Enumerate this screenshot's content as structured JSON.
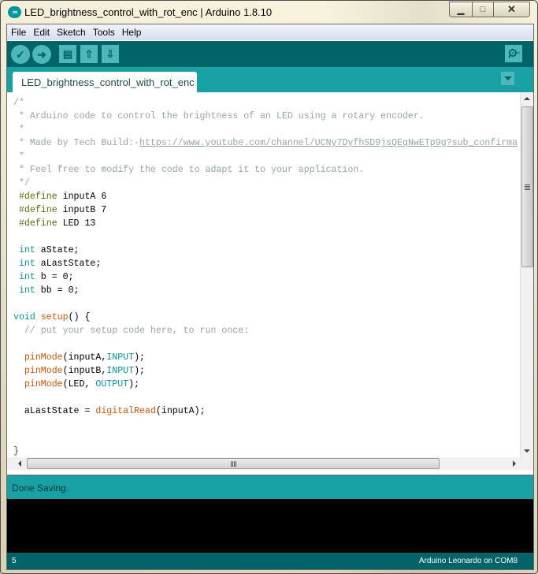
{
  "window": {
    "title": "LED_brightness_control_with_rot_enc | Arduino 1.8.10",
    "logo_glyph": "∞",
    "controls": {
      "minimize": "▁",
      "maximize": "□",
      "close": "✕"
    }
  },
  "menubar": {
    "items": [
      "File",
      "Edit",
      "Sketch",
      "Tools",
      "Help"
    ]
  },
  "toolbar": {
    "buttons": [
      {
        "name": "verify",
        "glyph": "✓"
      },
      {
        "name": "upload",
        "glyph": "➜"
      },
      {
        "name": "new",
        "glyph": "▤"
      },
      {
        "name": "open",
        "glyph": "⇧"
      },
      {
        "name": "save",
        "glyph": "⇩"
      }
    ],
    "serial_monitor": "serial-monitor"
  },
  "tabs": [
    {
      "label": "LED_brightness_control_with_rot_enc",
      "active": true
    }
  ],
  "editor": {
    "lines": [
      [
        {
          "t": "/*",
          "c": "comment"
        }
      ],
      [
        {
          "t": " * Arduino code to control the brightness of an LED using a rotary encoder.",
          "c": "comment"
        }
      ],
      [
        {
          "t": " *",
          "c": "comment"
        }
      ],
      [
        {
          "t": " * Made by Tech Build:-",
          "c": "comment"
        },
        {
          "t": "https://www.youtube.com/channel/UCNy7DyfhSD9jsQEqNwETp9g?sub_confirma",
          "c": "link"
        }
      ],
      [
        {
          "t": " *",
          "c": "comment"
        }
      ],
      [
        {
          "t": " * Feel free to modify the code to adapt it to your application.",
          "c": "comment"
        }
      ],
      [
        {
          "t": " */",
          "c": "comment"
        }
      ],
      [
        {
          "t": " #define",
          "c": "pre"
        },
        {
          "t": " inputA 6",
          "c": ""
        }
      ],
      [
        {
          "t": " #define",
          "c": "pre"
        },
        {
          "t": " inputB 7",
          "c": ""
        }
      ],
      [
        {
          "t": " #define",
          "c": "pre"
        },
        {
          "t": " LED 13",
          "c": ""
        }
      ],
      [
        {
          "t": "",
          "c": ""
        }
      ],
      [
        {
          "t": " int",
          "c": "type"
        },
        {
          "t": " aState;",
          "c": ""
        }
      ],
      [
        {
          "t": " int",
          "c": "type"
        },
        {
          "t": " aLastState;",
          "c": ""
        }
      ],
      [
        {
          "t": " int",
          "c": "type"
        },
        {
          "t": " b = 0;",
          "c": ""
        }
      ],
      [
        {
          "t": " int",
          "c": "type"
        },
        {
          "t": " bb = 0;",
          "c": ""
        }
      ],
      [
        {
          "t": "",
          "c": ""
        }
      ],
      [
        {
          "t": "void",
          "c": "void"
        },
        {
          "t": " ",
          "c": ""
        },
        {
          "t": "setup",
          "c": "func"
        },
        {
          "t": "() {",
          "c": ""
        }
      ],
      [
        {
          "t": "  // put your setup code here, to run once:",
          "c": "comment"
        }
      ],
      [
        {
          "t": "",
          "c": ""
        }
      ],
      [
        {
          "t": "  ",
          "c": ""
        },
        {
          "t": "pinMode",
          "c": "func"
        },
        {
          "t": "(inputA,",
          "c": ""
        },
        {
          "t": "INPUT",
          "c": "const"
        },
        {
          "t": ");",
          "c": ""
        }
      ],
      [
        {
          "t": "  ",
          "c": ""
        },
        {
          "t": "pinMode",
          "c": "func"
        },
        {
          "t": "(inputB,",
          "c": ""
        },
        {
          "t": "INPUT",
          "c": "const"
        },
        {
          "t": ");",
          "c": ""
        }
      ],
      [
        {
          "t": "  ",
          "c": ""
        },
        {
          "t": "pinMode",
          "c": "func"
        },
        {
          "t": "(LED, ",
          "c": ""
        },
        {
          "t": "OUTPUT",
          "c": "const"
        },
        {
          "t": ");",
          "c": ""
        }
      ],
      [
        {
          "t": "",
          "c": ""
        }
      ],
      [
        {
          "t": "  aLastState = ",
          "c": ""
        },
        {
          "t": "digitalRead",
          "c": "func"
        },
        {
          "t": "(inputA);",
          "c": ""
        }
      ],
      [
        {
          "t": "",
          "c": ""
        }
      ],
      [
        {
          "t": "",
          "c": ""
        }
      ],
      [
        {
          "t": "}",
          "c": "brace"
        }
      ]
    ]
  },
  "status": {
    "message": "Done Saving."
  },
  "footer": {
    "line_number": "5",
    "board": "Arduino Leonardo on COM8"
  },
  "colors": {
    "toolbar_bg": "#006468",
    "tab_bar_bg": "#17a1a5",
    "button_bg": "#4db7bb",
    "console_bg": "#000000"
  }
}
